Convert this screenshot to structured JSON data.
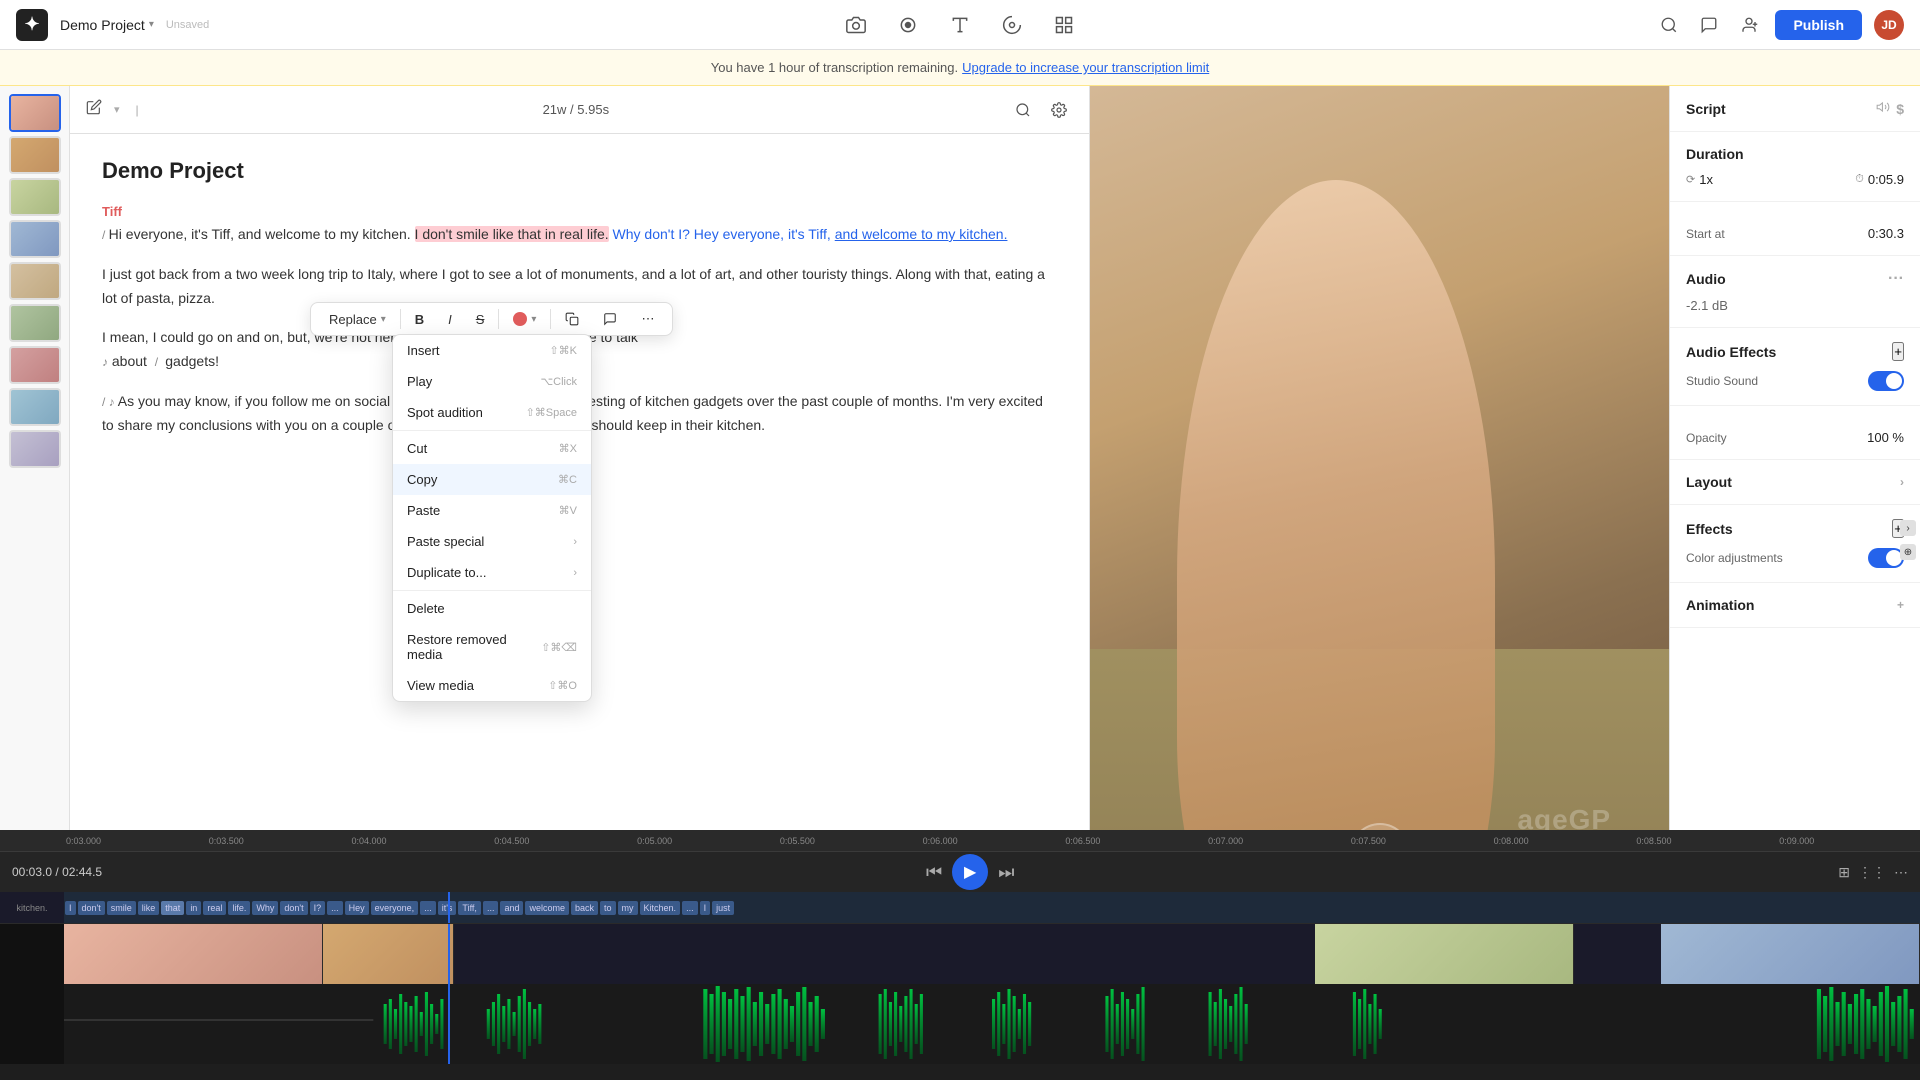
{
  "topbar": {
    "project_name": "Demo Project",
    "publish_label": "Publish",
    "avatar_initials": "JD",
    "unsaved": "Unsaved"
  },
  "banner": {
    "text": "You have 1 hour of transcription remaining.",
    "link": "Upgrade to increase your transcription limit"
  },
  "editor": {
    "title": "Demo Project",
    "word_count": "21w",
    "duration": "5.95s",
    "speaker": "Tiff",
    "paragraphs": [
      "/ Hi everyone, it's Tiff, and welcome to my kitchen. I don't smile like that in real life. Why don't I? Hey everyone, it's Tiff, and welcome to my kitchen.",
      "I just got back from a two week long trip to Italy, where I got to see a lot of monuments, and a lot of art, and other touristy things. Along with that, eating a lot of pasta, pizza.",
      "I mean, I could go on and on, but, we're not here to talk about travel. We're here to talk ♪ about / gadgets!",
      "/ ♪ As you may know, if you follow me on social media, I've been doing a lot of testing of kitchen gadgets over the past couple of months. I'm very excited to share my conclusions with you on a couple of gadgets that every home chef should keep in their kitchen."
    ]
  },
  "floating_toolbar": {
    "replace_label": "Replace",
    "bold_label": "B",
    "italic_label": "I",
    "strike_label": "S"
  },
  "context_menu": {
    "items": [
      {
        "label": "Insert",
        "shortcut": "⇧⌘K",
        "has_arrow": false
      },
      {
        "label": "Play",
        "shortcut": "⌥Click",
        "has_arrow": false
      },
      {
        "label": "Spot audition",
        "shortcut": "⇧⌘Space",
        "has_arrow": false
      },
      {
        "label": "Cut",
        "shortcut": "⌘X",
        "has_arrow": false
      },
      {
        "label": "Copy",
        "shortcut": "⌘C",
        "has_arrow": false
      },
      {
        "label": "Paste",
        "shortcut": "⌘V",
        "has_arrow": false
      },
      {
        "label": "Paste special",
        "shortcut": "",
        "has_arrow": true
      },
      {
        "label": "Duplicate to...",
        "shortcut": "",
        "has_arrow": true
      },
      {
        "label": "Delete",
        "shortcut": "",
        "has_arrow": false
      },
      {
        "label": "Restore removed media",
        "shortcut": "⇧⌘⌫",
        "has_arrow": false
      },
      {
        "label": "View media",
        "shortcut": "⇧⌘O",
        "has_arrow": false
      }
    ]
  },
  "right_panel": {
    "script_label": "Script",
    "duration_label": "Duration",
    "duration_speed": "1x",
    "duration_value": "0:05.9",
    "start_at_label": "Start at",
    "start_at_value": "0:30.3",
    "audio_label": "Audio",
    "audio_value": "-2.1 dB",
    "audio_effects_label": "Audio Effects",
    "studio_sound_label": "Studio Sound",
    "opacity_label": "Opacity",
    "opacity_value": "100 %",
    "layout_label": "Layout",
    "effects_label": "Effects",
    "color_adj_label": "Color adjustments",
    "animation_label": "Animation"
  },
  "timeline": {
    "current_time": "00:03.0",
    "total_time": "02:44.5",
    "markers": [
      "0:03.000",
      "0:03.500",
      "0:04.000",
      "0:04.500",
      "0:05.000",
      "0:05.500",
      "0:06.000",
      "0:06.500",
      "0:07.000",
      "0:07.500",
      "0:08.000",
      "0:08.500",
      "0:09.000"
    ],
    "words": [
      "I",
      "don't",
      "smile",
      "like",
      "that",
      "in",
      "real",
      "life.",
      "Why",
      "don't",
      "I?",
      "...",
      "Hey",
      "everyone,",
      "...",
      "it's",
      "Tiff,",
      "...",
      "and",
      "welcome",
      "back",
      "to",
      "my",
      "Kitchen.",
      "...",
      "I",
      "just"
    ],
    "watermark": "ageGP"
  }
}
